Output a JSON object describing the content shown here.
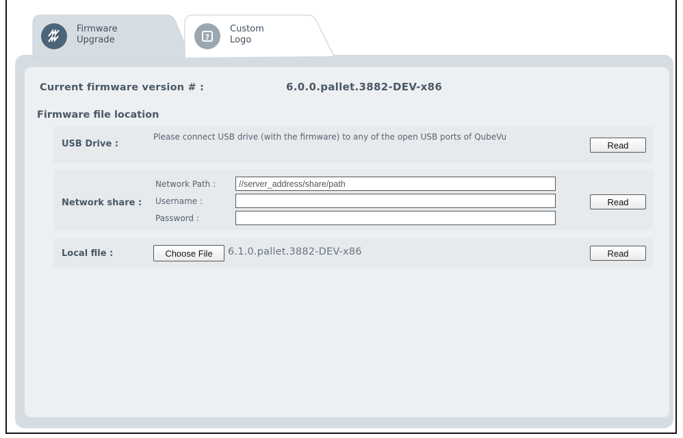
{
  "tabs": [
    {
      "label_line1": "Firmware",
      "label_line2": "Upgrade",
      "icon": "firmware-upgrade-icon",
      "active": true
    },
    {
      "label_line1": "Custom",
      "label_line2": "Logo",
      "icon": "custom-logo-icon",
      "active": false
    }
  ],
  "firmware": {
    "current_label": "Current firmware version # :",
    "current_value": "6.0.0.pallet.3882-DEV-x86",
    "section_title": "Firmware file location"
  },
  "usb": {
    "label": "USB Drive :",
    "message": "Please connect USB drive (with the firmware) to any of the open USB ports of QubeVu",
    "read_label": "Read"
  },
  "network": {
    "label": "Network share :",
    "path_label": "Network Path :",
    "path_placeholder": "//server_address/share/path",
    "path_value": "",
    "username_label": "Username :",
    "username_value": "",
    "password_label": "Password :",
    "password_value": "",
    "read_label": "Read"
  },
  "local": {
    "label": "Local file :",
    "choose_label": "Choose File",
    "file_name": "6.1.0.pallet.3882-DEV-x86",
    "read_label": "Read"
  },
  "colors": {
    "panel_outer": "#d6dde2",
    "panel_inner": "#edf0f2",
    "row_bg": "#e6eaed",
    "text": "#4a5866",
    "tab_icon_active": "#4c6478",
    "tab_icon_inactive": "#9aa6b0"
  }
}
